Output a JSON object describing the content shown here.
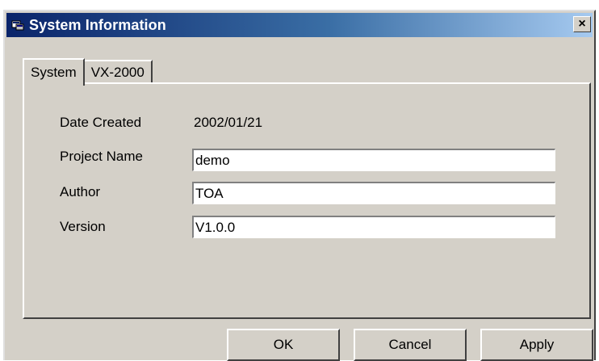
{
  "window": {
    "title": "System Information",
    "close_label": "×"
  },
  "tabs": [
    {
      "label": "System",
      "active": true
    },
    {
      "label": "VX-2000",
      "active": false
    }
  ],
  "system": {
    "date_created_label": "Date Created",
    "date_created_value": "2002/01/21",
    "project_name_label": "Project Name",
    "project_name_value": "demo",
    "author_label": "Author",
    "author_value": "TOA",
    "version_label": "Version",
    "version_value": "V1.0.0"
  },
  "buttons": {
    "ok": "OK",
    "cancel": "Cancel",
    "apply": "Apply"
  },
  "colors": {
    "title_bar_start": "#0a246a",
    "title_bar_end": "#a6caf0",
    "face": "#d4d0c8"
  },
  "icons": {
    "app": "app-icon",
    "close": "close-icon"
  }
}
